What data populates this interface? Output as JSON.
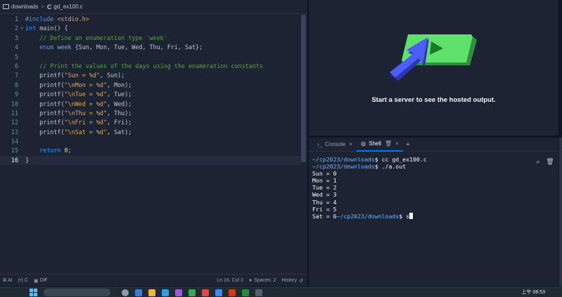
{
  "breadcrumb": {
    "folder": "downloads",
    "separator": ">",
    "file_icon": "C",
    "file": "gd_ex100.c"
  },
  "editor": {
    "lines": [
      {
        "n": "1",
        "fold": "",
        "code": "#include <stdio.h>"
      },
      {
        "n": "2",
        "fold": "v",
        "code": "int main() {"
      },
      {
        "n": "3",
        "fold": "",
        "code": "    // Define an enumeration type 'week'"
      },
      {
        "n": "4",
        "fold": "",
        "code": "    enum week {Sun, Mon, Tue, Wed, Thu, Fri, Sat};"
      },
      {
        "n": "5",
        "fold": "",
        "code": ""
      },
      {
        "n": "6",
        "fold": "",
        "code": "    // Print the values of the days using the enumeration constants"
      },
      {
        "n": "7",
        "fold": "",
        "code": "    printf(\"Sun = %d\", Sun);"
      },
      {
        "n": "8",
        "fold": "",
        "code": "    printf(\"\\nMon = %d\", Mon);"
      },
      {
        "n": "9",
        "fold": "",
        "code": "    printf(\"\\nTue = %d\", Tue);"
      },
      {
        "n": "10",
        "fold": "",
        "code": "    printf(\"\\nWed = %d\", Wed);"
      },
      {
        "n": "11",
        "fold": "",
        "code": "    printf(\"\\nThu = %d\", Thu);"
      },
      {
        "n": "12",
        "fold": "",
        "code": "    printf(\"\\nFri = %d\", Fri);"
      },
      {
        "n": "13",
        "fold": "",
        "code": "    printf(\"\\nSat = %d\", Sat);"
      },
      {
        "n": "14",
        "fold": "",
        "code": ""
      },
      {
        "n": "15",
        "fold": "",
        "code": "    return 0;"
      },
      {
        "n": "16",
        "fold": "",
        "code": "}"
      }
    ],
    "active_line": 16
  },
  "statusbar": {
    "ai": "AI",
    "lang": "C",
    "diff": "Diff",
    "position": "Ln 16, Col 2",
    "spaces": "Spaces: 2",
    "history": "History"
  },
  "webview": {
    "message": "Start a server to see the hosted output."
  },
  "console": {
    "tabs": [
      {
        "label": "Console",
        "icon": "terminal-prompt-icon"
      },
      {
        "label": "Shell",
        "icon": "shell-icon"
      }
    ],
    "active_tab": "Shell",
    "lines": [
      {
        "path": "~/cp2023/downloads",
        "rest": "$ cc gd_ex100.c"
      },
      {
        "path": "~/cp2023/downloads",
        "rest": "$ ./a.out"
      },
      {
        "path": "",
        "rest": "Sun = 0"
      },
      {
        "path": "",
        "rest": "Mon = 1"
      },
      {
        "path": "",
        "rest": "Tue = 2"
      },
      {
        "path": "",
        "rest": "Wed = 3"
      },
      {
        "path": "",
        "rest": "Thu = 4"
      },
      {
        "path": "",
        "rest": "Fri = 5"
      }
    ],
    "last_line": {
      "prefix": "Sat = 6",
      "path": "~/cp2023/downloads",
      "rest": "$ s"
    }
  },
  "taskbar": {
    "clock": "上午 08:53"
  },
  "colors": {
    "editor_bg": "#1c2333",
    "accent": "#0079f2",
    "green_screen": "#5fe26b",
    "arrow_blue": "#4d5ef7"
  }
}
